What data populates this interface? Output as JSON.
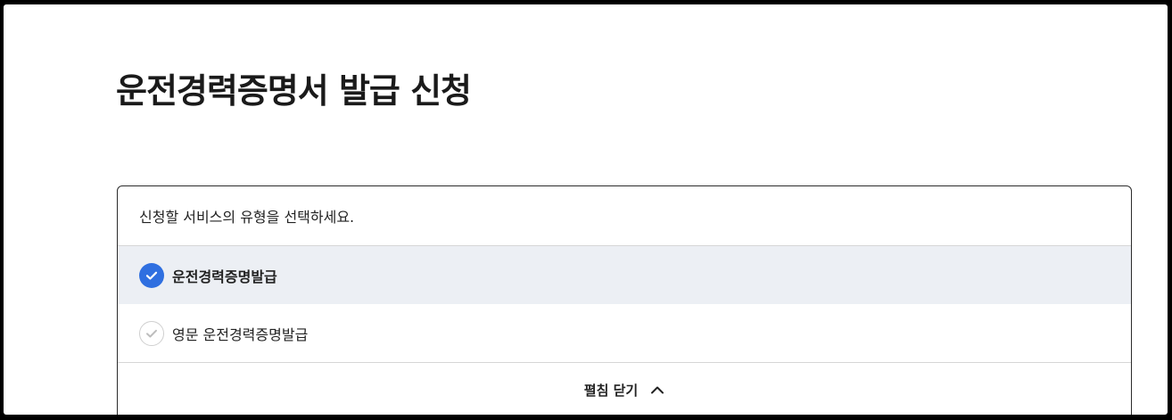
{
  "page": {
    "title": "운전경력증명서 발급 신청"
  },
  "service_select": {
    "instruction": "신청할 서비스의 유형을 선택하세요.",
    "options": [
      {
        "label": "운전경력증명발급",
        "selected": true
      },
      {
        "label": "영문 운전경력증명발급",
        "selected": false
      }
    ],
    "toggle_label": "펼침 닫기"
  },
  "colors": {
    "accent": "#2f6fe0",
    "selected_bg": "#eceff4"
  },
  "icons": {
    "check_selected": "check-circle-filled-icon",
    "check_unselected": "check-circle-outline-icon",
    "toggle": "chevron-up-icon"
  }
}
